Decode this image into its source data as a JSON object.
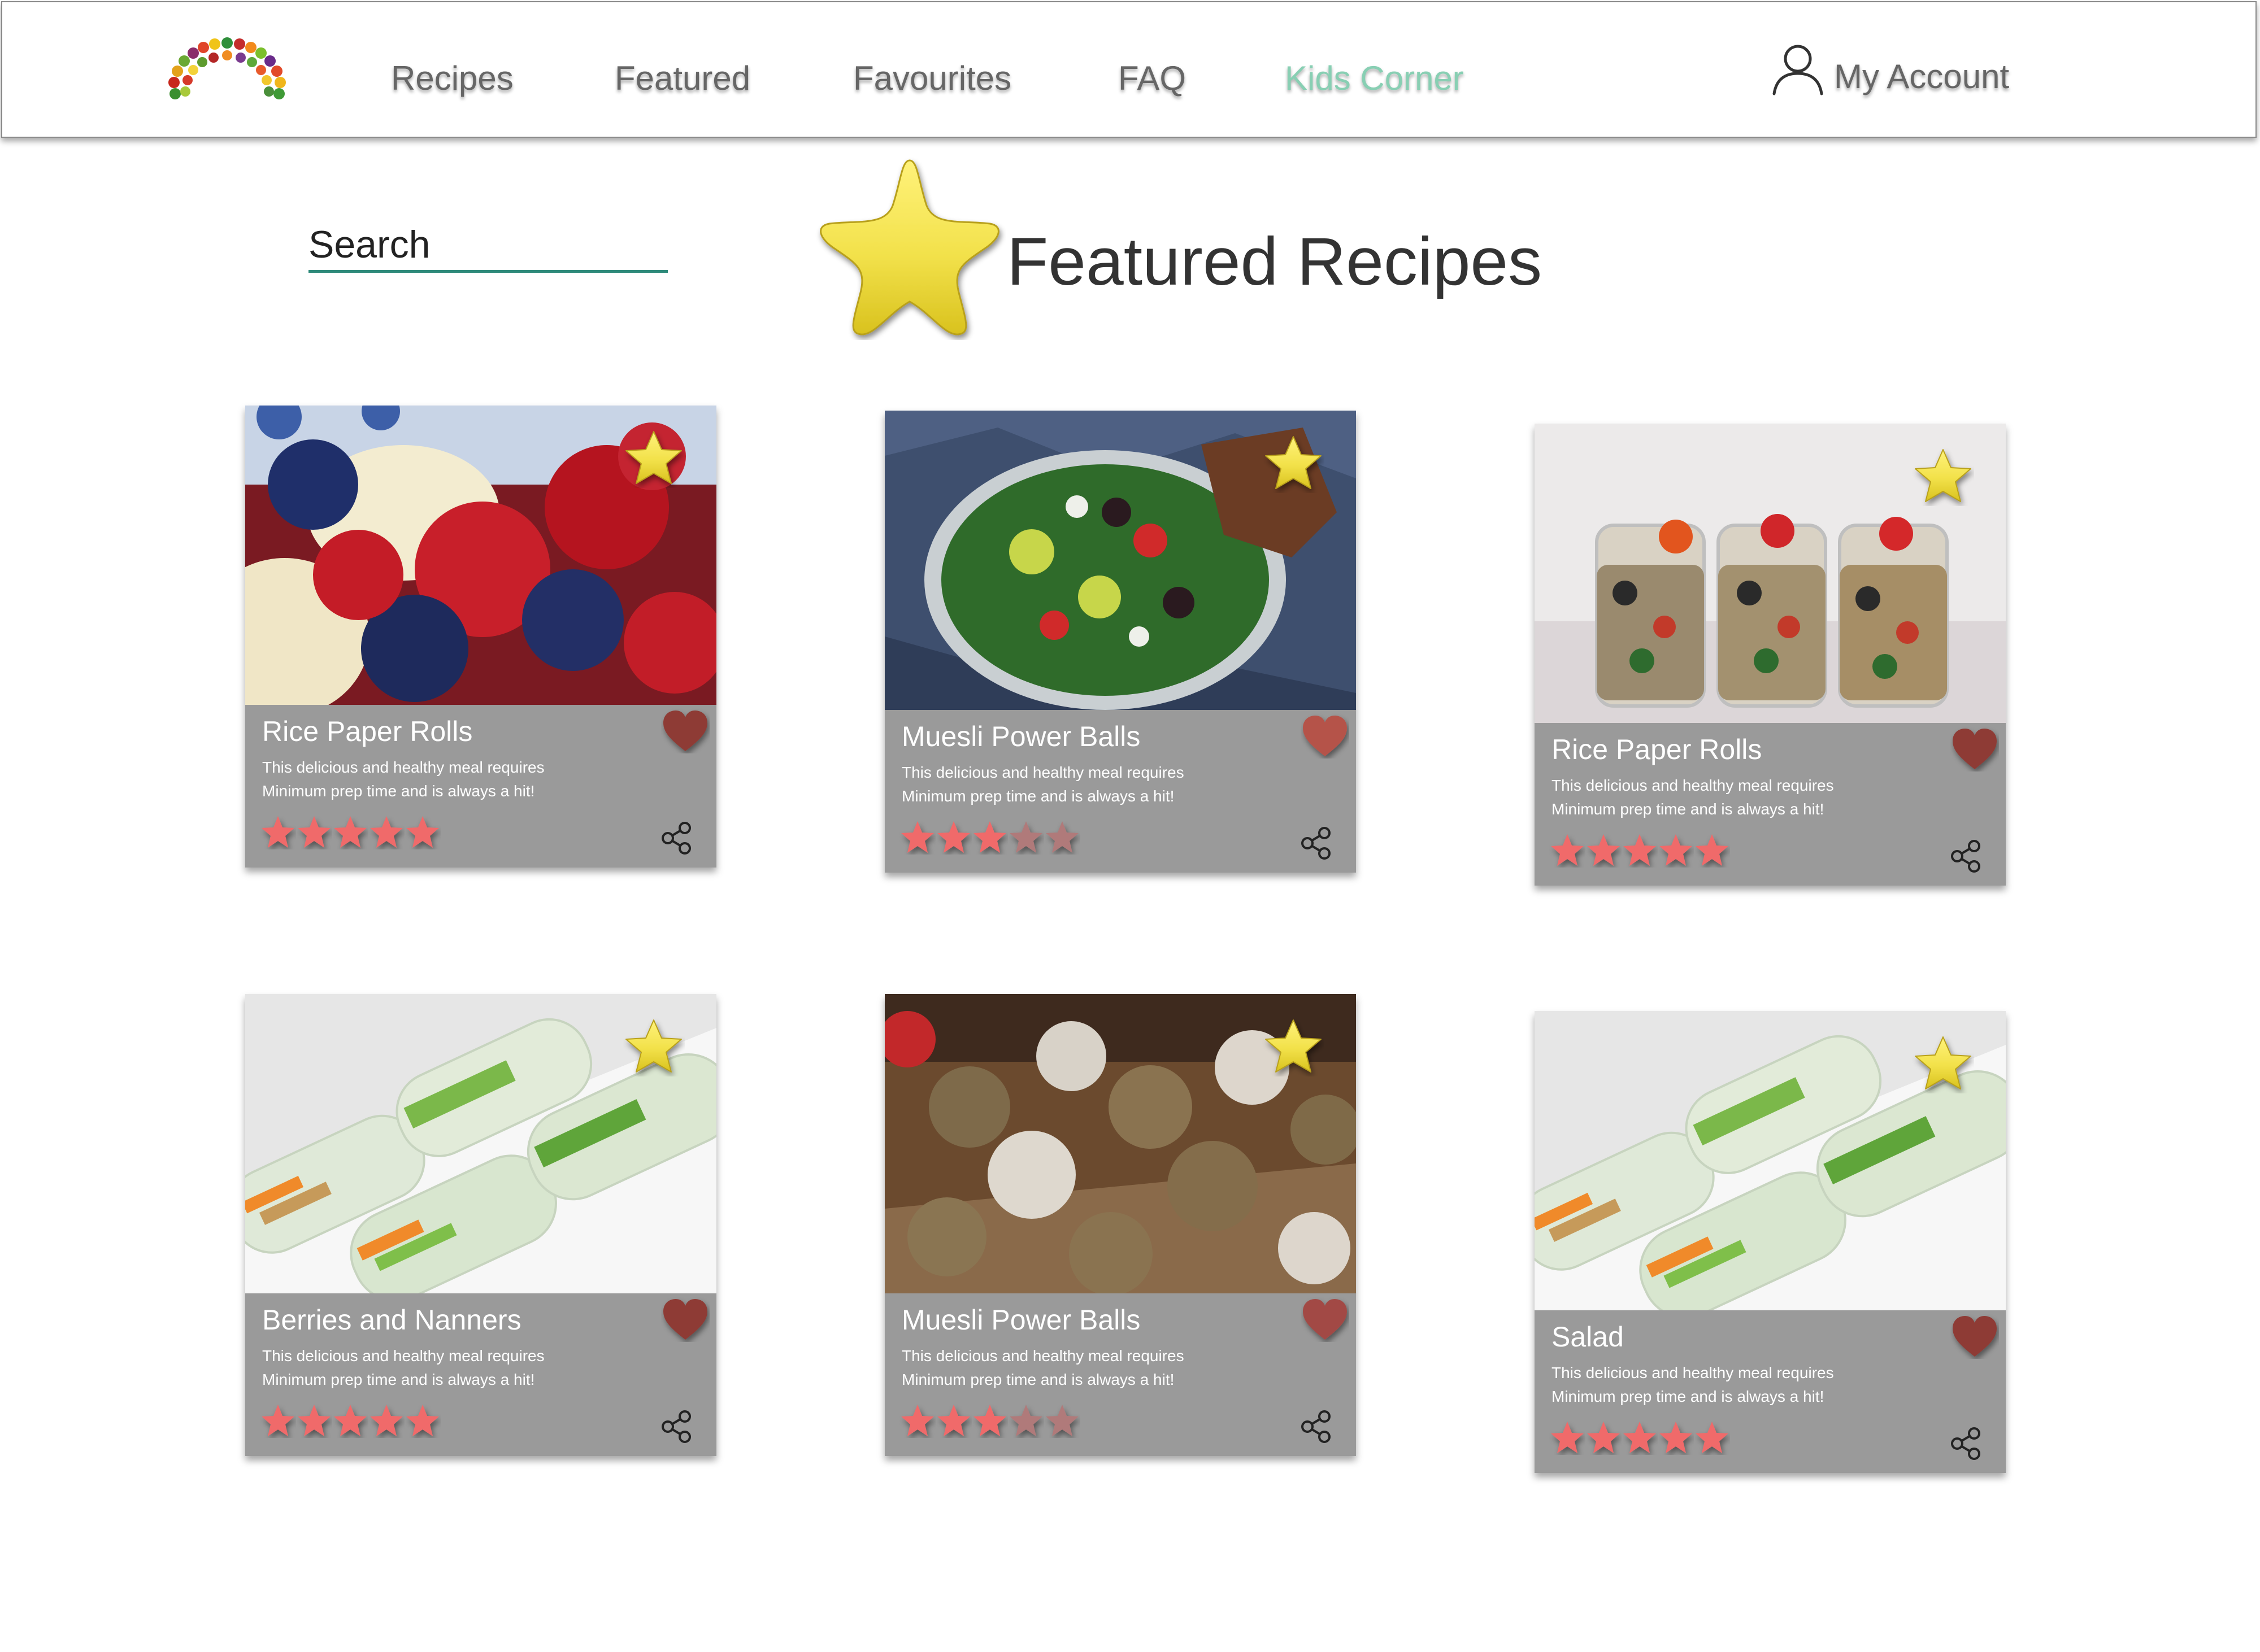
{
  "nav": {
    "items": [
      {
        "label": "Recipes",
        "active": false
      },
      {
        "label": "Featured",
        "active": false
      },
      {
        "label": "Favourites",
        "active": false
      },
      {
        "label": "FAQ",
        "active": false
      },
      {
        "label": "Kids Corner",
        "active": true
      }
    ],
    "account_label": "My Account",
    "logo_icon": "rainbow-fruit-logo",
    "account_icon": "user-icon"
  },
  "search": {
    "placeholder": "Search"
  },
  "page": {
    "title": "Featured Recipes",
    "title_icon": "star-icon"
  },
  "colors": {
    "accent": "#88cfb3",
    "search_underline": "#2e8a7a",
    "card_background": "#9a9a9a",
    "star_yellow": "#f2e14a",
    "heart": "#8e3b34",
    "rating_active": "#f06a6a",
    "rating_inactive": "#b07a7a"
  },
  "cards": [
    {
      "title": "Rice Paper Rolls",
      "desc_line1": "This delicious and healthy meal requires",
      "desc_line2": "Minimum prep time and is always a hit!",
      "rating": 5,
      "image": "berries-and-bananas-photo"
    },
    {
      "title": "Muesli Power Balls",
      "desc_line1": "This delicious and healthy meal requires",
      "desc_line2": "Minimum prep time and is always a hit!",
      "rating": 3,
      "image": "salad-bowl-photo"
    },
    {
      "title": "Rice Paper Rolls",
      "desc_line1": "This delicious and healthy meal requires",
      "desc_line2": "Minimum prep time and is always a hit!",
      "rating": 5,
      "image": "quinoa-jars-photo"
    },
    {
      "title": "Berries and Nanners",
      "desc_line1": "This delicious and healthy meal requires",
      "desc_line2": "Minimum prep time and is always a hit!",
      "rating": 5,
      "image": "rice-paper-rolls-photo"
    },
    {
      "title": "Muesli Power Balls",
      "desc_line1": "This delicious and healthy meal requires",
      "desc_line2": "Minimum prep time and is always a hit!",
      "rating": 3,
      "image": "energy-balls-photo"
    },
    {
      "title": "Salad",
      "desc_line1": "This delicious and healthy meal requires",
      "desc_line2": "Minimum prep time and is always a hit!",
      "rating": 5,
      "image": "rice-paper-rolls-photo"
    }
  ]
}
